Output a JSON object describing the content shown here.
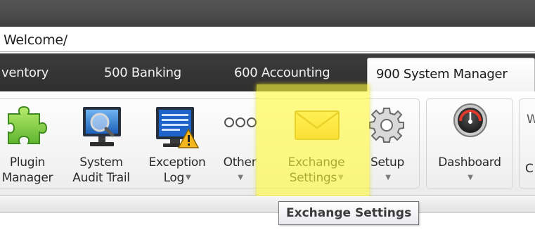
{
  "address_bar": {
    "path": "Welcome/"
  },
  "tabs": [
    {
      "label": "ventory"
    },
    {
      "label": "500 Banking"
    },
    {
      "label": "600 Accounting"
    },
    {
      "label": "900 System Manager",
      "active": true
    }
  ],
  "ribbon": {
    "plugin_manager": {
      "line1": "Plugin",
      "line2": "Manager",
      "icon": "puzzle-piece-icon"
    },
    "system_audit_trail": {
      "line1": "System",
      "line2": "Audit Trail",
      "icon": "monitor-search-icon"
    },
    "exception_log": {
      "line1": "Exception",
      "line2": "Log",
      "icon": "log-warning-icon"
    },
    "other": {
      "line1": "Other",
      "icon": "ellipsis-icon"
    },
    "exchange_settings": {
      "line1": "Exchange",
      "line2": "Settings",
      "icon": "envelope-icon"
    },
    "setup": {
      "line1": "Setup",
      "icon": "gear-icon"
    },
    "dashboard": {
      "line1": "Dashboard",
      "icon": "speedometer-icon"
    },
    "clipped_top": "W",
    "clipped_bottom": "C"
  },
  "tooltip": {
    "text": "Exchange Settings"
  },
  "colors": {
    "highlight": "#fff83c",
    "tab_bar": "#333333",
    "top_bar": "#4b4b4b"
  }
}
